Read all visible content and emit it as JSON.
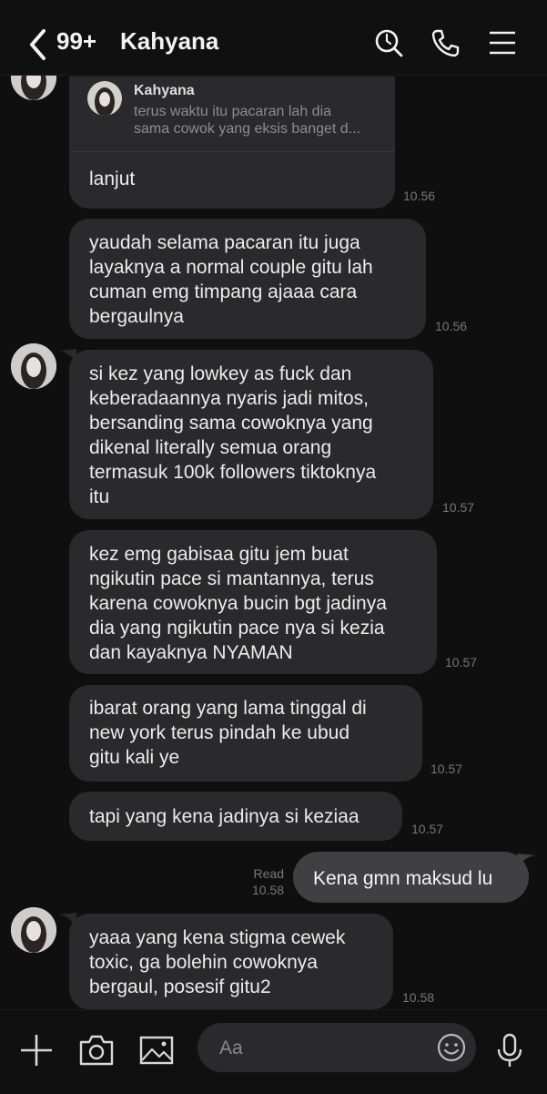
{
  "header": {
    "back_icon": "chevron-left-icon",
    "unread_count": "99+",
    "contact_name": "Kahyana",
    "icons": [
      "search-icon",
      "phone-icon",
      "menu-icon"
    ]
  },
  "messages": [
    {
      "reply_to": {
        "name": "Kahyana",
        "text_lines": [
          "terus waktu itu pacaran lah dia",
          "sama cowok yang eksis banget d..."
        ]
      },
      "lines": [
        "lanjut"
      ],
      "time": "10.56"
    },
    {
      "lines": [
        "yaudah selama pacaran itu juga",
        "layaknya a normal couple gitu lah",
        "cuman emg timpang ajaaa cara",
        "bergaulnya"
      ],
      "time": "10.56"
    },
    {
      "lines": [
        "si kez yang lowkey as fuck dan",
        "keberadaannya nyaris jadi mitos,",
        "bersanding sama cowoknya yang",
        "dikenal literally semua orang",
        "termasuk 100k followers tiktoknya",
        "itu"
      ],
      "time": "10.57"
    },
    {
      "lines": [
        "kez emg gabisaa gitu jem buat",
        "ngikutin pace si mantannya, terus",
        "karena cowoknya bucin bgt jadinya",
        "dia yang ngikutin pace nya si kezia",
        "dan kayaknya NYAMAN"
      ],
      "time": "10.57"
    },
    {
      "lines": [
        "ibarat orang yang lama tinggal di",
        "new york terus pindah ke ubud",
        "gitu kali ye"
      ],
      "time": "10.57"
    },
    {
      "lines": [
        "tapi yang kena jadinya si keziaa"
      ],
      "time": "10.57"
    },
    {
      "sent": true,
      "text": "Kena gmn maksud lu",
      "read_label": "Read",
      "time": "10.58"
    },
    {
      "lines": [
        "yaaa yang kena stigma cewek",
        "toxic, ga bolehin cowoknya",
        "bergaul, posesif gitu2"
      ],
      "time": "10.58"
    }
  ],
  "composer": {
    "placeholder": "Aa",
    "icons": [
      "plus-icon",
      "camera-icon",
      "image-icon",
      "emoji-icon",
      "microphone-icon"
    ]
  },
  "colors": {
    "background": "#0f0f10",
    "received_bubble": "#2a2a2c",
    "sent_bubble": "#404043",
    "timestamp": "#777777"
  }
}
